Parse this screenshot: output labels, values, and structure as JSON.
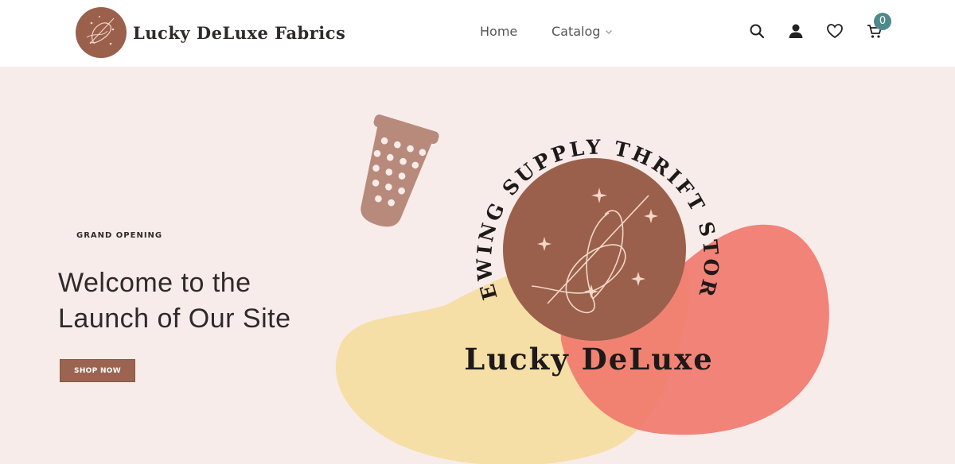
{
  "header": {
    "brand_name": "Lucky DeLuxe Fabrics",
    "nav": [
      {
        "label": "Home"
      },
      {
        "label": "Catalog"
      }
    ],
    "icons": {
      "search": "search-icon",
      "account": "account-icon",
      "wishlist": "heart-icon",
      "cart": "cart-icon"
    },
    "cart_count": "0"
  },
  "hero": {
    "eyebrow": "GRAND OPENING",
    "headline": "Welcome to the Launch of Our Site",
    "cta_label": "SHOP NOW",
    "logo_arc_text": "SEWING SUPPLY THRIFT STORE",
    "logo_wordmark": "Lucky DeLuxe"
  },
  "colors": {
    "background": "#f8ecea",
    "brand_brown": "#9a604c",
    "button_brown": "#9a6451",
    "thimble": "#b88a7c",
    "yellow_blob": "#f5dfa7",
    "coral_blob": "#f07a6e",
    "cart_badge": "#4f8a8b",
    "text_dark": "#2f2a2a"
  }
}
